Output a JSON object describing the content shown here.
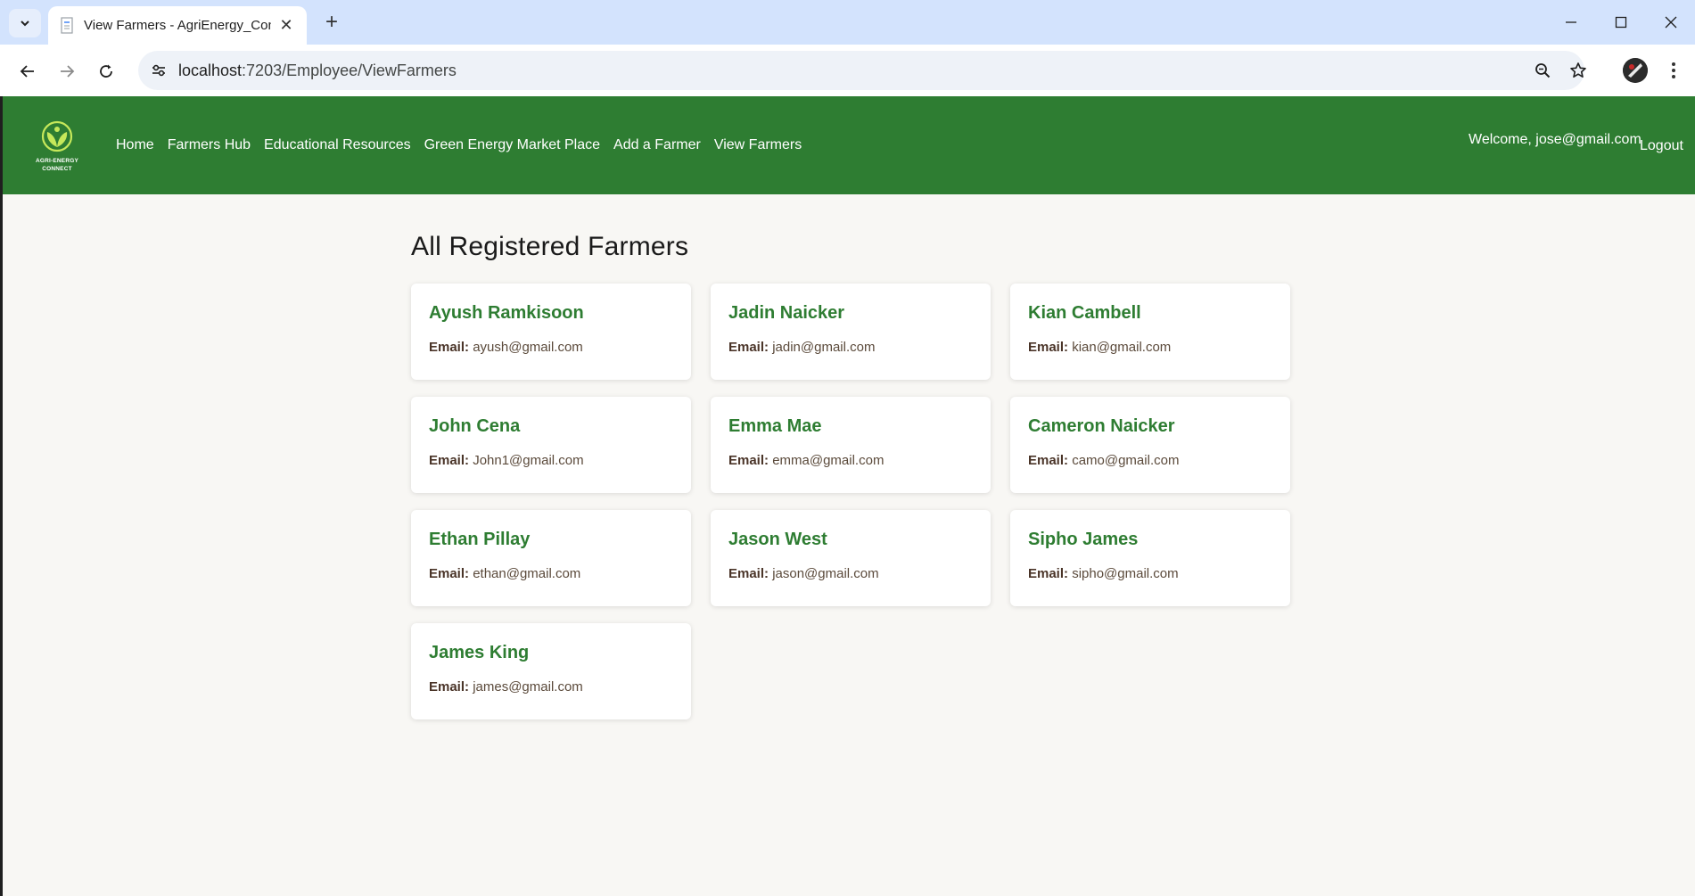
{
  "browser": {
    "tab_title": "View Farmers - AgriEnergy_Con",
    "url_host": "localhost",
    "url_path": ":7203/Employee/ViewFarmers"
  },
  "nav": {
    "logo_text_line1": "AGRI-ENERGY",
    "logo_text_line2": "CONNECT",
    "links": [
      "Home",
      "Farmers Hub",
      "Educational Resources",
      "Green Energy Market Place",
      "Add a Farmer",
      "View Farmers"
    ],
    "welcome": "Welcome, jose@gmail.com",
    "logout": "Logout",
    "color": "#2e7d32"
  },
  "main": {
    "title": "All Registered Farmers",
    "email_label": "Email:",
    "farmers": [
      {
        "name": "Ayush Ramkisoon",
        "email": "ayush@gmail.com"
      },
      {
        "name": "Jadin Naicker",
        "email": "jadin@gmail.com"
      },
      {
        "name": "Kian Cambell",
        "email": "kian@gmail.com"
      },
      {
        "name": "John Cena",
        "email": "John1@gmail.com"
      },
      {
        "name": "Emma Mae",
        "email": "emma@gmail.com"
      },
      {
        "name": "Cameron Naicker",
        "email": "camo@gmail.com"
      },
      {
        "name": "Ethan Pillay",
        "email": "ethan@gmail.com"
      },
      {
        "name": "Jason West",
        "email": "jason@gmail.com"
      },
      {
        "name": "Sipho James",
        "email": "sipho@gmail.com"
      },
      {
        "name": "James King",
        "email": "james@gmail.com"
      }
    ]
  }
}
